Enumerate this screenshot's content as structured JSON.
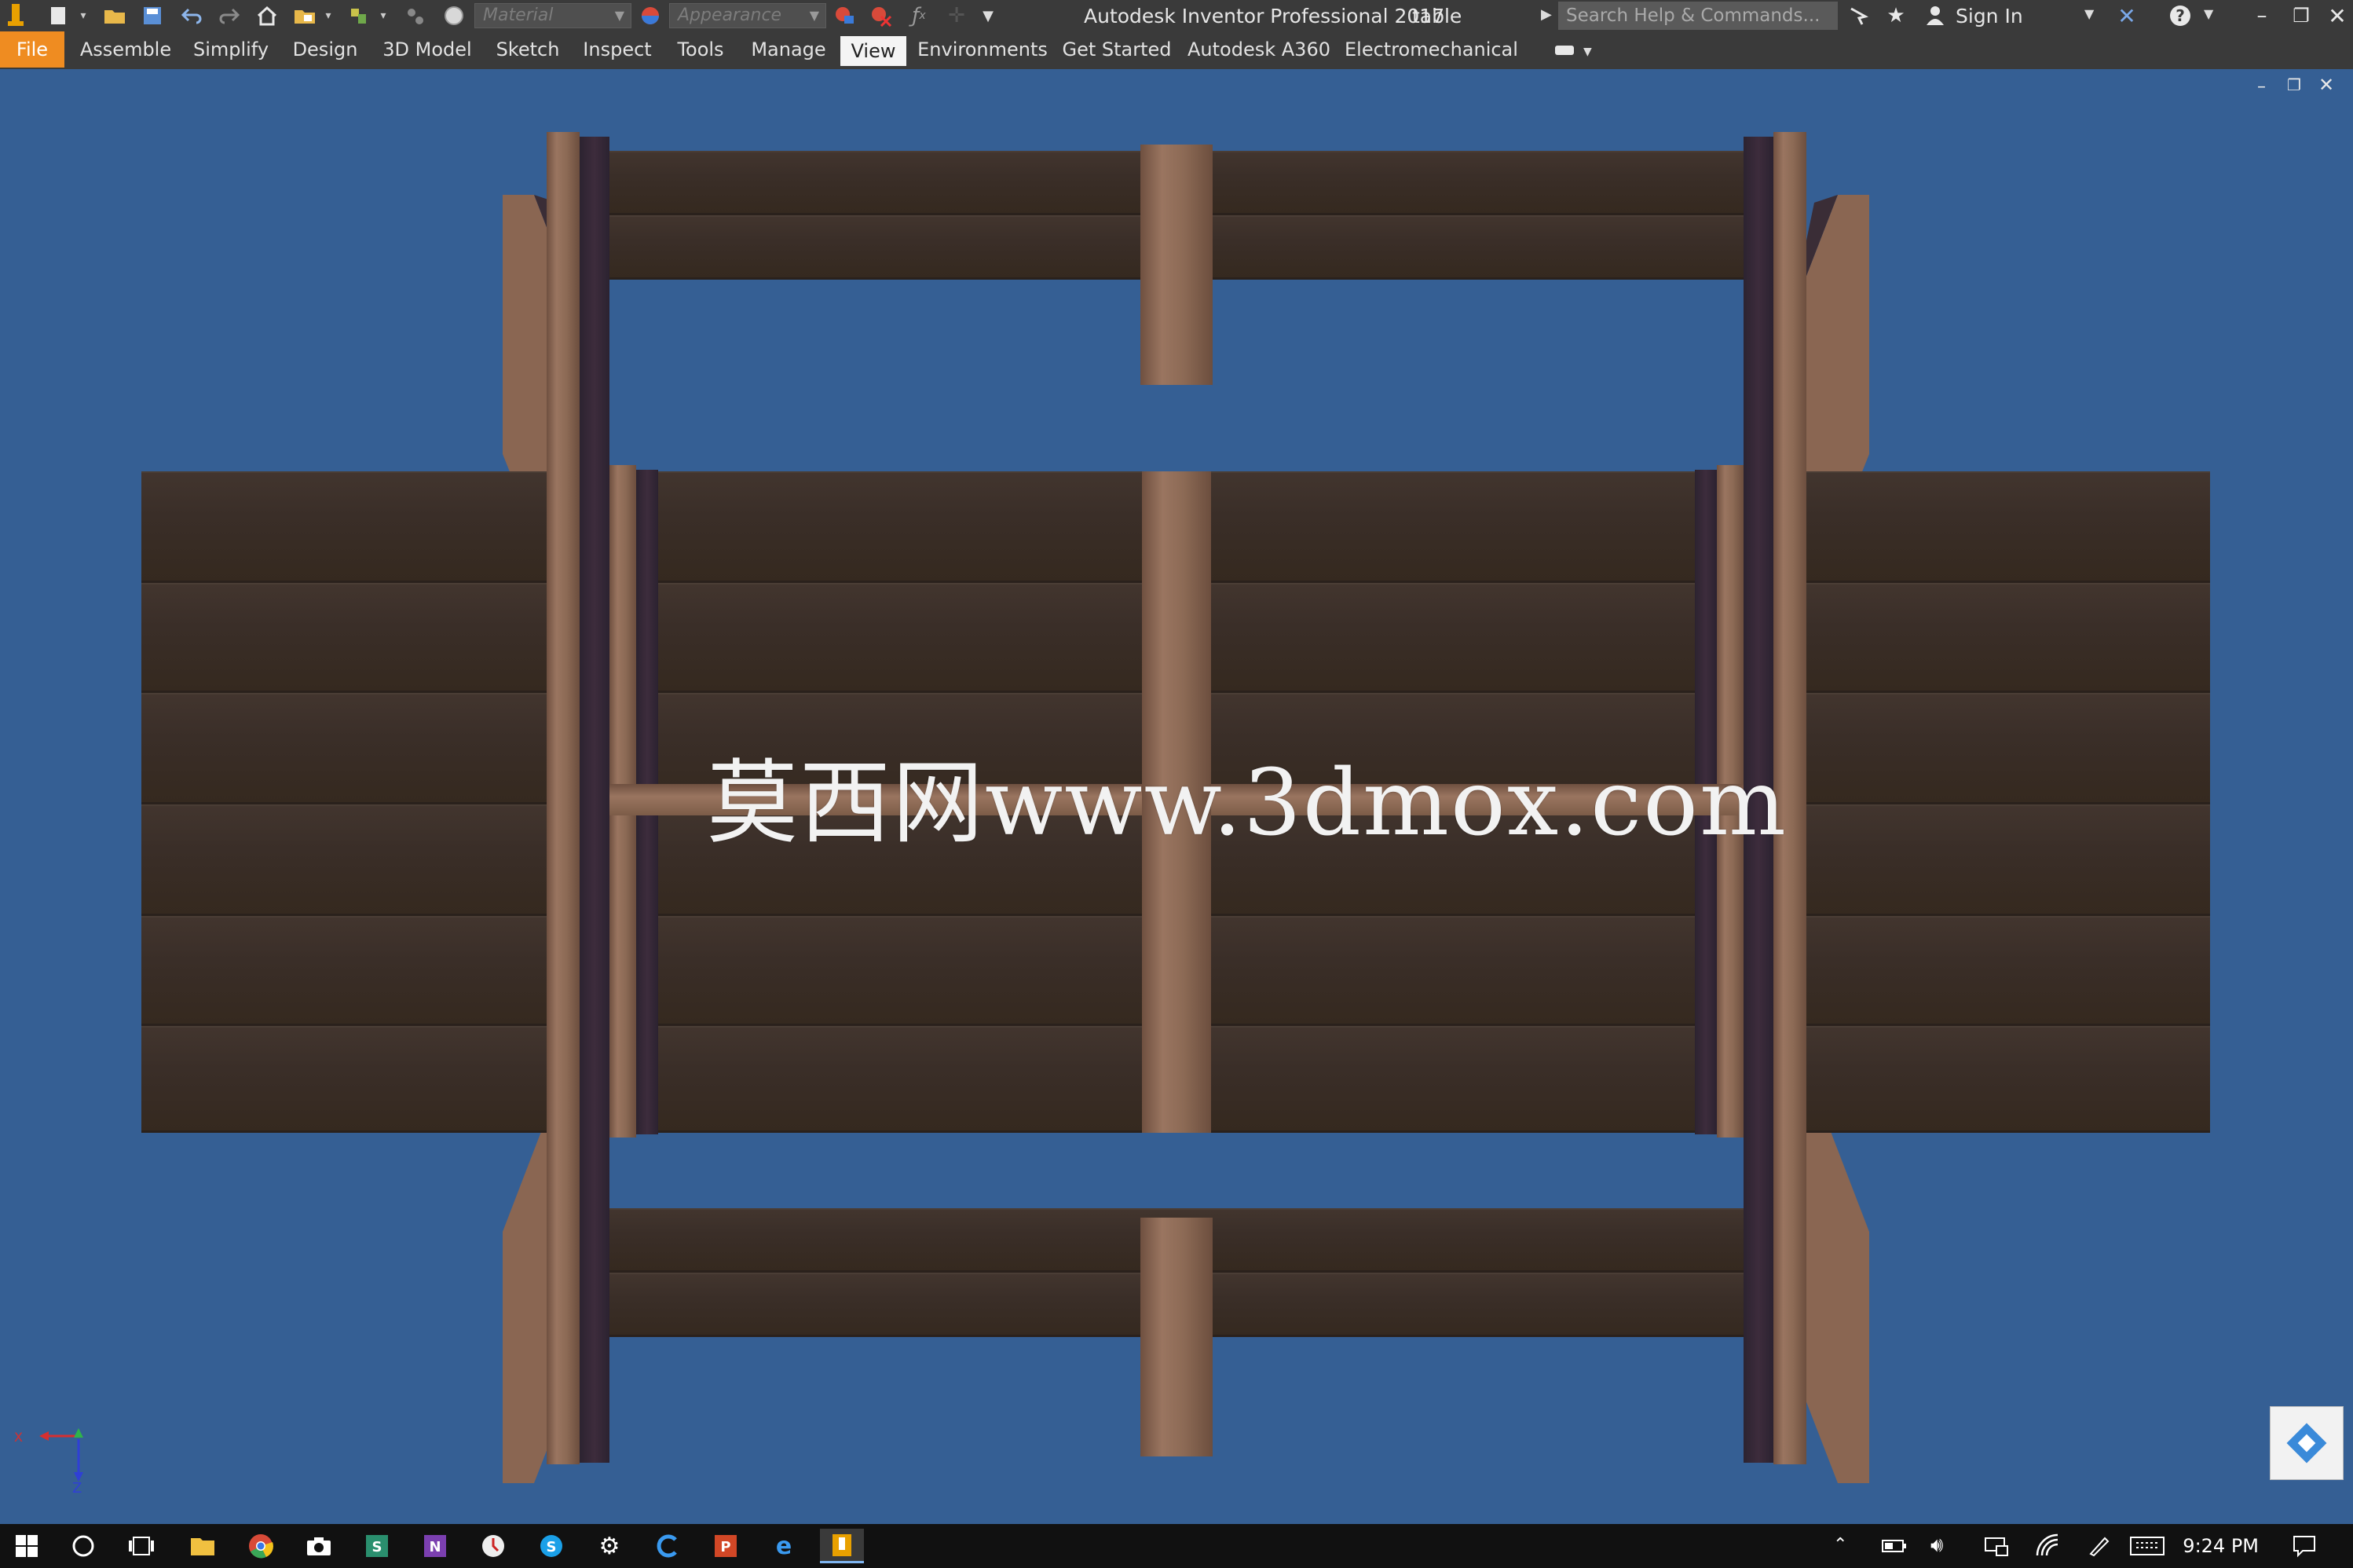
{
  "titlebar": {
    "app_title": "Autodesk Inventor Professional 2017",
    "document": "table",
    "material_placeholder": "Material",
    "appearance_placeholder": "Appearance",
    "search_placeholder": "Search Help & Commands...",
    "sign_in": "Sign In"
  },
  "ribbon": {
    "tabs": [
      "File",
      "Assemble",
      "Simplify",
      "Design",
      "3D Model",
      "Sketch",
      "Inspect",
      "Tools",
      "Manage",
      "View",
      "Environments",
      "Get Started",
      "Autodesk A360",
      "Electromechanical"
    ],
    "active_tab": "View"
  },
  "viewport": {
    "watermark": "莫西网www.3dmox.com",
    "axis_labels": {
      "x": "X",
      "y": "Y",
      "z": "Z"
    },
    "background_color": "#355f94"
  },
  "taskbar": {
    "clock": "9:24 PM"
  },
  "colors": {
    "file_tab": "#ef8c21",
    "titlebar_bg": "#3a3a3a",
    "canvas_bg": "#355f94"
  }
}
